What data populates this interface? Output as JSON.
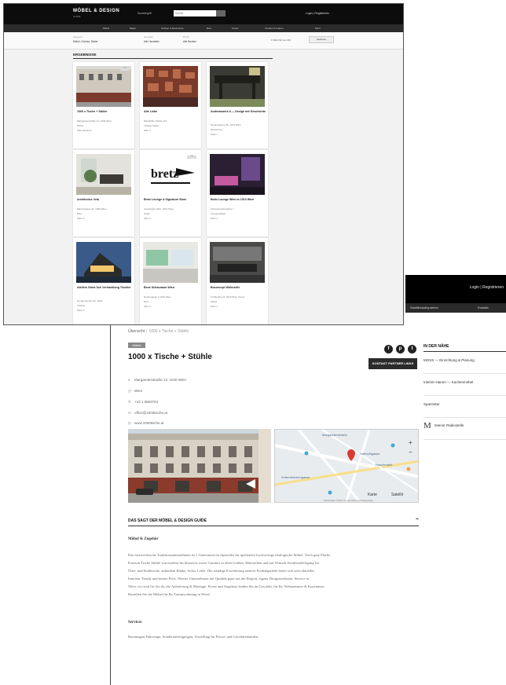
{
  "detail": {
    "login": "Login | Registrieren",
    "nav": [
      "Sanitärstudiopartner",
      "Kontakt"
    ],
    "breadcrumb": {
      "home": "Übersicht",
      "sep": "|",
      "current": "1000 x Tische + Stühle"
    },
    "category": "Möbel",
    "title": "1000 x Tische + Stühle",
    "social": [
      "f",
      "p",
      "t"
    ],
    "contact_button": "KONTAKT PARTNER LINKS",
    "info": [
      {
        "icon": "pin-icon",
        "glyph": "⌖",
        "text": "Margaretenstraße 12, 1040 Wien"
      },
      {
        "icon": "clock-icon",
        "glyph": "◷",
        "text": "Wien"
      },
      {
        "icon": "phone-icon",
        "glyph": "✆",
        "text": "+43 1 5863753"
      },
      {
        "icon": "mail-icon",
        "glyph": "✉",
        "text": "office@1000tische.at"
      },
      {
        "icon": "web-icon",
        "glyph": "⊡",
        "text": "www.1000tische.at"
      }
    ],
    "map_labels": [
      "Margaretenstraße",
      "Kettenbrückengasse",
      "Hofmühlgasse",
      "Naschmarkt"
    ],
    "map_buttons": {
      "plus": "+",
      "minus": "−",
      "karte": "Karte",
      "satellit": "Satellit",
      "footer": "Kartendaten ©2024 Google   Nutzungsbedingungen"
    },
    "section_title": "DAS SAGT DER MÖBEL & DESIGN GUIDE",
    "section_toggle": "−",
    "sub_title": "Möbel & Zugehör",
    "paragraphs": [
      "Das österreichische Traditionsunternehmen ist 1 Generation im Spezialist für qualitative hochwertige ökologische Möbel. Tisch gute Fläche",
      "Esstisch Tische Stühle von modern bis klassisch sowie Garnitur in allen Größen, Materialien und auf Wunsch Sonderanfertigung für",
      "Über- und Stahltische, außerdem Bänke, Sofas, Leder. Die ständige Erweiterung unserer Produktpalette bietet sich stets aktuelles",
      "Interieur Trends und besten Preis. Wiener Unternehmen mit Qualität ganz aus der Region, eigene Designwerkstatt. Service in",
      "Wien, wir sind für Sie da, die Anlieferung & Montage. Preise und Angebote finden Sie im Geschäft, für Ihr Wohnzimmer & Esszimmer,",
      "Bestellen Sie die Möbel für Ihr Traumwohnung in Wien!"
    ],
    "services_title": "Services",
    "services_text": "Beratungen Fahrzeuge, Sonderanfertigungen, Zustellung für Privat- und Geschäftskunden",
    "nearby": {
      "title": "IN DER NÄHE",
      "items": [
        {
          "label": "MOSS — Einrichtung & Planung",
          "logo": ""
        },
        {
          "label": "Interiör-Hamm — Küchenmöbel",
          "logo": ""
        },
        {
          "label": "Spannstar",
          "logo": ""
        },
        {
          "label": "Interior Radiostelle",
          "logo": "M"
        }
      ]
    }
  },
  "list": {
    "logo": "MÖBEL & DESIGN",
    "logo_sub": "GUIDE",
    "search_label": "Suchbegriff",
    "search_placeholder": "Suche",
    "login": "Login | Registrieren",
    "nav": [
      "Möbel",
      "Bäder",
      "Küchen & Esszimmer",
      "Büro",
      "Kinder",
      "Outdoor & Garten",
      "Mehr"
    ],
    "filters": [
      {
        "label": "Kategorie",
        "value": "Möbel, Küchen, Bäder"
      },
      {
        "label": "Hersteller",
        "value": "Alle Hersteller"
      },
      {
        "label": "Bezirk",
        "value": "Alle Bezirke"
      }
    ],
    "count": "1 Wien 62 von 234",
    "sort": "Sortieren",
    "results_title": "ERGEBNISSE",
    "cards": [
      {
        "title": "1000 x Tische + Stühle",
        "lines": [
          "Margaretenstraße 12, 1040 Wien",
          "Möbel",
          "Wien Zentrum"
        ],
        "tag": "TOP"
      },
      {
        "title": "Alte Liebe",
        "lines": [
          "Mariahilfer Straße 114",
          "Vintage Möbel",
          "Wien 7"
        ],
        "tag": ""
      },
      {
        "title": "Andreaswerk 8 — Design mit Geschichte",
        "lines": [
          "Neubaugasse 55, 1070 Wien",
          "Einrichtung",
          "Wien 7"
        ],
        "tag": ""
      },
      {
        "title": "Architonics Vela",
        "lines": [
          "Marxergasse 24, 1030 Wien",
          "Büro",
          "Wien 3"
        ],
        "tag": ""
      },
      {
        "title": "Bretz Lounge & Signature Store",
        "lines": [
          "Josefsplatz 2/Dc, 1010 Wien",
          "Sofas",
          "Wien 1"
        ],
        "tag": "TOP"
      },
      {
        "title": "Bretz Lounge Wien in 1010 Wien",
        "lines": [
          "Schwarzenbergplatz 7",
          "Lounge Möbel",
          "Wien 1"
        ],
        "tag": ""
      },
      {
        "title": "Ateliers Sales Sch Verhandlung Tischler",
        "lines": [
          "Gumpendorfer Str. 1040",
          "Tischler",
          "Wien 6"
        ],
        "tag": ""
      },
      {
        "title": "Bene Schauraum Wien",
        "lines": [
          "Neutorgasse 4 1010 Wien",
          "Büro",
          "Wien 1"
        ],
        "tag": ""
      },
      {
        "title": "Boconcept Wohnzelle",
        "lines": [
          "Tuchlauben 8, 1010 Wien Innere",
          "Möbel",
          "Wien 1"
        ],
        "tag": ""
      }
    ]
  }
}
